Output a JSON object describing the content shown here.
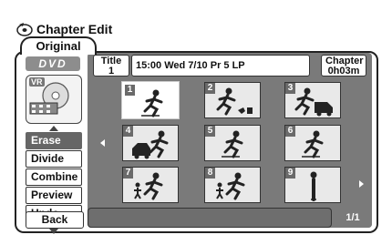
{
  "screen": {
    "title": "Chapter Edit",
    "tab": "Original"
  },
  "disc": {
    "type": "DVD",
    "mode": "VR"
  },
  "menu": [
    {
      "label": "Erase",
      "selected": true
    },
    {
      "label": "Divide",
      "selected": false
    },
    {
      "label": "Combine",
      "selected": false
    },
    {
      "label": "Preview",
      "selected": false
    },
    {
      "label": "Undo",
      "selected": false
    }
  ],
  "back_label": "Back",
  "info": {
    "title_label": "Title",
    "title_number": "1",
    "details": "15:00 Wed  7/10 Pr 5   LP",
    "chapter_label": "Chapter",
    "chapter_time": "0h03m"
  },
  "thumbnails": [
    {
      "num": "1",
      "icon": "skater-icon",
      "selected": true
    },
    {
      "num": "2",
      "icon": "skater-with-dog-icon",
      "selected": false
    },
    {
      "num": "3",
      "icon": "skater-with-truck-icon",
      "selected": false
    },
    {
      "num": "4",
      "icon": "skater-with-car-icon",
      "selected": false
    },
    {
      "num": "5",
      "icon": "skater-icon",
      "selected": false
    },
    {
      "num": "6",
      "icon": "skater-icon",
      "selected": false
    },
    {
      "num": "7",
      "icon": "skater-with-child-icon",
      "selected": false
    },
    {
      "num": "8",
      "icon": "skater-with-child-icon",
      "selected": false
    },
    {
      "num": "9",
      "icon": "standing-person-icon",
      "selected": false
    }
  ],
  "page": "1/1"
}
